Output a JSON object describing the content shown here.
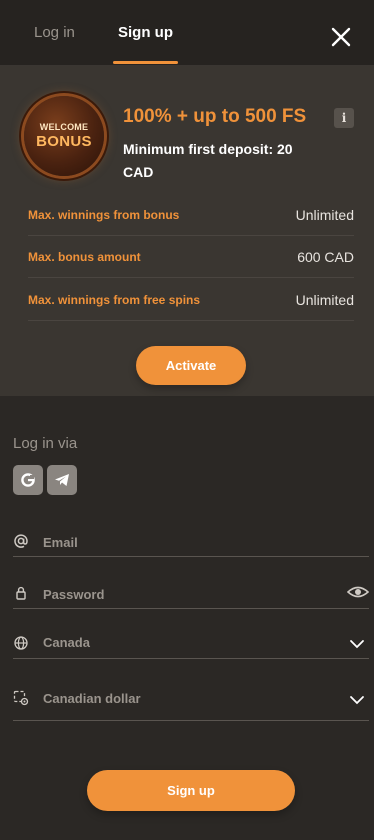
{
  "tabs": {
    "login": "Log in",
    "signup": "Sign up",
    "active": "signup"
  },
  "bonus": {
    "coin_line1": "WELCOME",
    "coin_line2": "BONUS",
    "title": "100% + up to 500 FS",
    "info": "i",
    "subtitle": "Minimum first deposit: 20 CAD",
    "rows": [
      {
        "label": "Max. winnings from bonus",
        "value": "Unlimited"
      },
      {
        "label": "Max. bonus amount",
        "value": "600 CAD"
      },
      {
        "label": "Max. winnings from free spins",
        "value": "Unlimited"
      }
    ],
    "activate_label": "Activate"
  },
  "login_via": {
    "label": "Log in via",
    "providers": [
      {
        "icon": "google-icon"
      },
      {
        "icon": "telegram-icon"
      }
    ]
  },
  "form": {
    "email_placeholder": "Email",
    "password_placeholder": "Password",
    "country": "Canada",
    "currency": "Canadian dollar"
  },
  "signup_label": "Sign up",
  "colors": {
    "accent": "#f0923a",
    "background": "#2b2825",
    "panel": "#3a3631"
  }
}
